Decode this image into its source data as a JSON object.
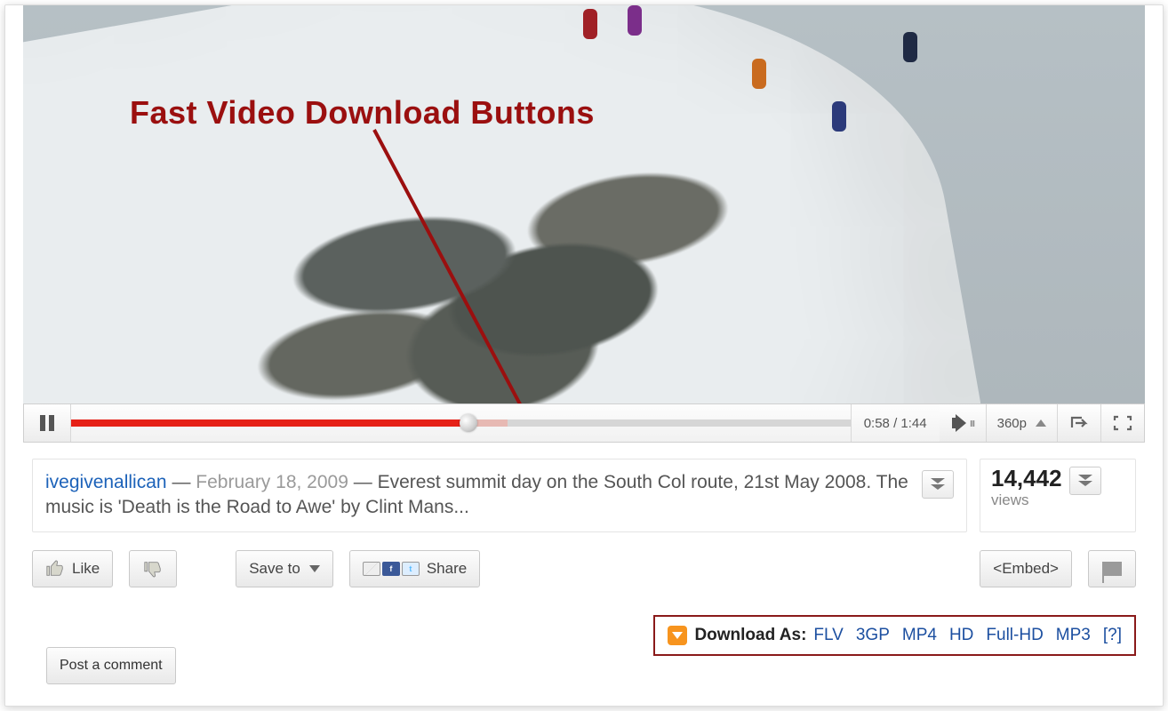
{
  "annotation": {
    "label": "Fast Video Download Buttons"
  },
  "player": {
    "time_current": "0:58",
    "time_total": "1:44",
    "quality": "360p"
  },
  "description": {
    "uploader": "ivegivenallican",
    "date": "February 18, 2009",
    "text": "Everest summit day on the South Col route, 21st May 2008. The music is 'Death is the Road to Awe' by Clint Mans..."
  },
  "views": {
    "count": "14,442",
    "label": "views"
  },
  "actions": {
    "like": "Like",
    "save_to": "Save to",
    "share": "Share",
    "embed": "<Embed>",
    "post_comment": "Post a comment"
  },
  "download": {
    "label": "Download As:",
    "formats": [
      "FLV",
      "3GP",
      "MP4",
      "HD",
      "Full-HD",
      "MP3",
      "[?]"
    ]
  }
}
